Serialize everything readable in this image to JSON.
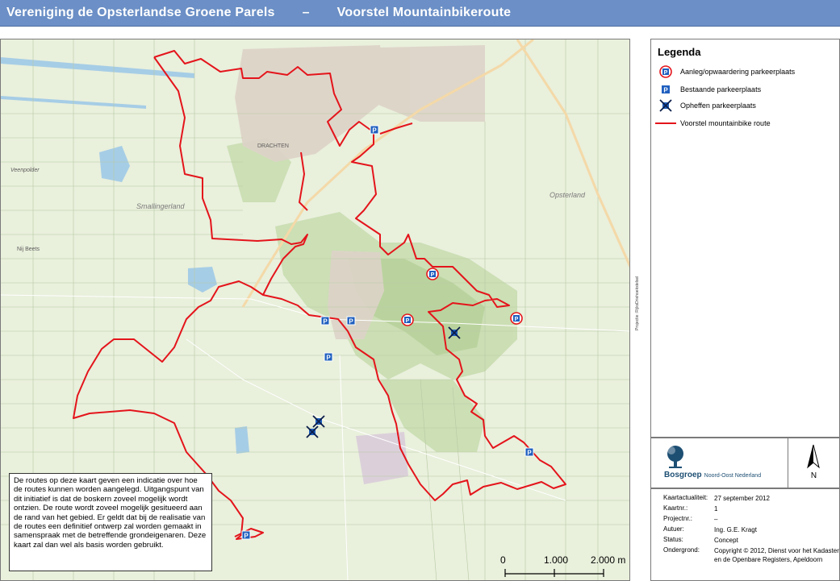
{
  "header": {
    "organisation": "Vereniging de Opsterlandse Groene Parels",
    "separator": "–",
    "subject": "Voorstel Mountainbikeroute"
  },
  "map": {
    "place_labels": [
      "DRACHTEN",
      "Smallingerland",
      "Opsterland",
      "Veenpolder",
      "Nij Beets"
    ],
    "route_color": "#e4141b",
    "projection_note": "Projectie: RijksDriehoekstelsel",
    "info_text": "De routes op deze kaart geven een indicatie over hoe de routes kunnen worden aangelegd. Uitgangspunt van dit initiatief is dat de boskern zoveel mogelijk wordt ontzien. De route wordt zoveel mogelijk gesitueerd aan de rand van het gebied. Er geldt dat bij de realisatie van de routes een definitief ontwerp zal worden gemaakt in samenspraak met de betreffende grondeigenaren. Deze kaart zal dan wel als basis worden gebruikt.",
    "scale": {
      "labels": [
        "0",
        "1.000",
        "2.000 m"
      ],
      "ticks_m": [
        0,
        1000,
        2000
      ]
    }
  },
  "legend": {
    "title": "Legenda",
    "items": [
      {
        "label": "Aanleg/opwaardering parkeerplaats",
        "icon": "parking-upgrade-icon"
      },
      {
        "label": "Bestaande parkeerplaats",
        "icon": "parking-existing-icon"
      },
      {
        "label": "Opheffen parkeerplaats",
        "icon": "parking-remove-icon"
      },
      {
        "label": "Voorstel mountainbike route",
        "icon": "route-line-icon"
      }
    ]
  },
  "branding": {
    "logo_name": "Bosgroep",
    "logo_sub": "Noord-Oost Nederland",
    "north_label": "N"
  },
  "metadata": [
    {
      "key": "Kaartactualiteit:",
      "value": "27 september 2012"
    },
    {
      "key": "Kaartnr.:",
      "value": "1"
    },
    {
      "key": "Projectnr.:",
      "value": "–"
    },
    {
      "key": "Autuer:",
      "value": "Ing. G.E. Kragt"
    },
    {
      "key": "Status:",
      "value": "Concept"
    },
    {
      "key": "Ondergrond:",
      "value": "Copyright © 2012, Dienst voor het Kadaster en de Openbare Registers, Apeldoorn"
    }
  ],
  "colors": {
    "title_bar": "#6b8fc6",
    "route": "#e4141b",
    "parking_blue": "#1f5fbf",
    "map_base": "#e9f0dc"
  }
}
